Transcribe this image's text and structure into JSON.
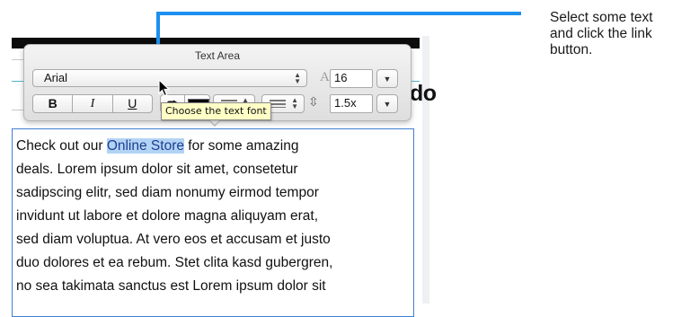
{
  "callout": {
    "line1": "Select some text",
    "line2": "and click the link",
    "line3": "button."
  },
  "page": {
    "heading_fragment": "do"
  },
  "popover": {
    "title": "Text Area",
    "font": {
      "value": "Arial"
    },
    "size": {
      "value": "16"
    },
    "line_spacing": {
      "value": "1.5x"
    },
    "style_buttons": {
      "bold": "B",
      "italic": "I",
      "underline": "U"
    },
    "link_glyph": "⮫"
  },
  "tooltip": {
    "text": "Choose the text font"
  },
  "text_area": {
    "line1_before": "Check out our ",
    "line1_selected": "Online Store",
    "line1_after": " for some amazing",
    "line2": "deals. Lorem ipsum dolor sit amet, consetetur",
    "line3": "sadipscing elitr, sed diam nonumy eirmod tempor",
    "line4": "invidunt ut labore et dolore magna aliquyam erat,",
    "line5": "sed diam voluptua. At vero eos et accusam et justo",
    "line6": "duo dolores et ea rebum. Stet clita kasd gubergren,",
    "line7": "no sea takimata sanctus est Lorem ipsum dolor sit"
  },
  "colors": {
    "accent": "#1c8ff0",
    "selection": "#b3d3f5",
    "tooltip_bg": "#ffffc6",
    "text_area_border": "#3f7fcf"
  },
  "icons": [
    "font-size-icon",
    "line-spacing-icon",
    "link-icon",
    "color-well-icon",
    "align-icon",
    "list-icon",
    "chevron-down-icon",
    "up-down-icon",
    "cursor-icon"
  ]
}
